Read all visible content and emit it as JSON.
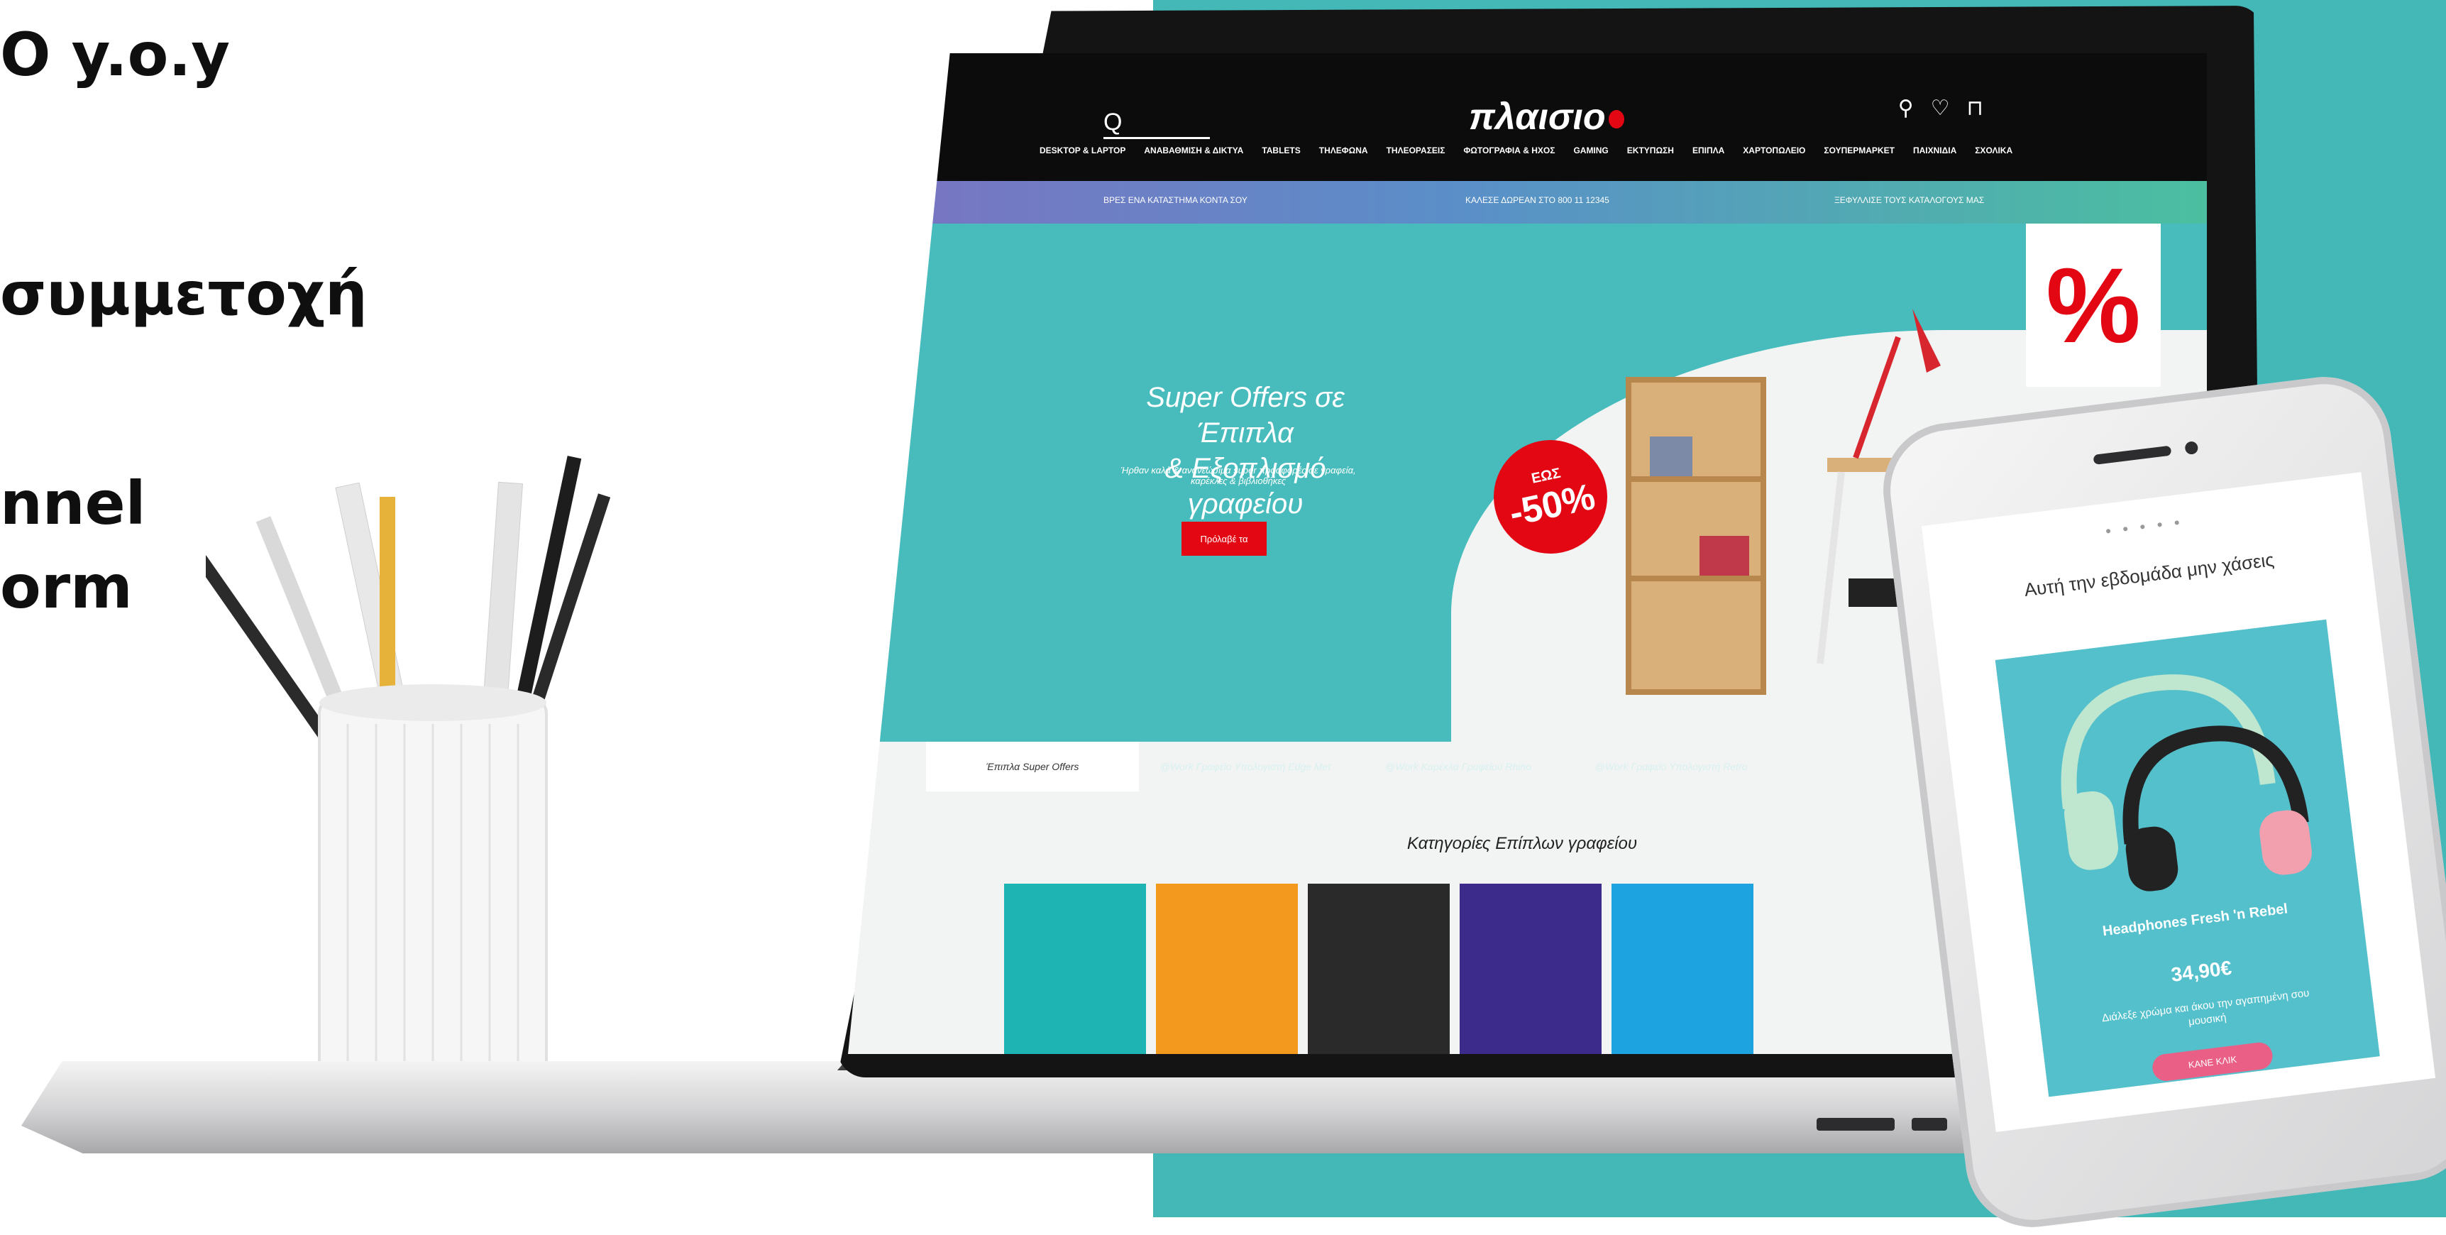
{
  "left_panel": {
    "line1": "O y.o.y",
    "line2": "συμμετοχή",
    "line3": "nnel",
    "line4": "orm"
  },
  "site": {
    "logo": "πλαισιο",
    "search_glyph": "Q",
    "header_icons": [
      "user-icon",
      "heart-icon",
      "cart-icon"
    ],
    "nav": [
      "DESKTOP & LAPTOP",
      "ΑΝΑΒΑΘΜΙΣΗ & ΔΙΚΤΥΑ",
      "TABLETS",
      "ΤΗΛΕΦΩΝΑ",
      "ΤΗΛΕΟΡΑΣΕΙΣ",
      "ΦΩΤΟΓΡΑΦΙΑ & ΗΧΟΣ",
      "GAMING",
      "ΕΚΤΥΠΩΣΗ",
      "ΕΠΙΠΛΑ",
      "ΧΑΡΤΟΠΩΛΕΙΟ",
      "ΣΟΥΠΕΡΜΑΡΚΕΤ",
      "ΠΑΙΧΝΙΔΙΑ",
      "ΣΧΟΛΙΚΑ"
    ],
    "info": [
      "ΒΡΕΣ ΕΝΑ ΚΑΤΑΣΤΗΜΑ ΚΟΝΤΑ ΣΟΥ",
      "ΚΑΛΕΣΕ ΔΩΡΕΑΝ ΣΤΟ 800 11 12345",
      "ΞΕΦΥΛΛΙΣΕ ΤΟΥΣ ΚΑΤΑΛΟΓΟΥΣ ΜΑΣ"
    ],
    "hero": {
      "title_l1": "Super Offers σε Έπιπλα",
      "title_l2": "& Εξοπλισμό γραφείου",
      "subtitle": "Ήρθαν καλά & ανανεώσιμα super προσφορές σε γραφεία, καρέκλες & βιβλιοθήκες",
      "cta": "Πρόλαβέ τα",
      "badge_upto": "ΕΩΣ",
      "badge_pct": "-50%",
      "tag_symbol": "%"
    },
    "tabs": [
      "Έπιπλα Super Offers",
      "@Work Γραφείο Υπολογιστή Edge Met",
      "@Work Καρέκλα Γραφείου Rhino",
      "@Work Γραφείο Υπολογιστή Retro"
    ],
    "categories_title": "Κατηγορίες Επίπλων γραφείου",
    "category_tiles": [
      "#1fb4b4",
      "#f39a1e",
      "#2a2a2a",
      "#3d2b8c",
      "#1da3e0"
    ]
  },
  "phone": {
    "dots": "● ● ● ● ●",
    "heading": "Αυτή την εβδομάδα μην χάσεις",
    "product": "Headphones Fresh 'n Rebel",
    "price": "34,90€",
    "description": "Διάλεξε χρώμα και άκου την αγαπημένη σου μουσική",
    "cta": "ΚΑΝΕ ΚΛΙΚ"
  }
}
